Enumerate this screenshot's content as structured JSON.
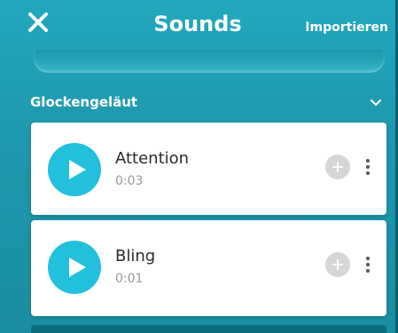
{
  "header": {
    "title": "Sounds",
    "import_label": "Importieren",
    "close_icon": "close-icon"
  },
  "category": {
    "label": "Glockengeläut",
    "icon": "chevron-down-icon"
  },
  "sounds": [
    {
      "name": "Attention",
      "duration": "0:03"
    },
    {
      "name": "Bling",
      "duration": "0:01"
    }
  ],
  "colors": {
    "panel_bg": "#22a8be",
    "accent": "#22c0dc",
    "card_bg": "#ffffff",
    "add_button": "#d6d6d6"
  }
}
